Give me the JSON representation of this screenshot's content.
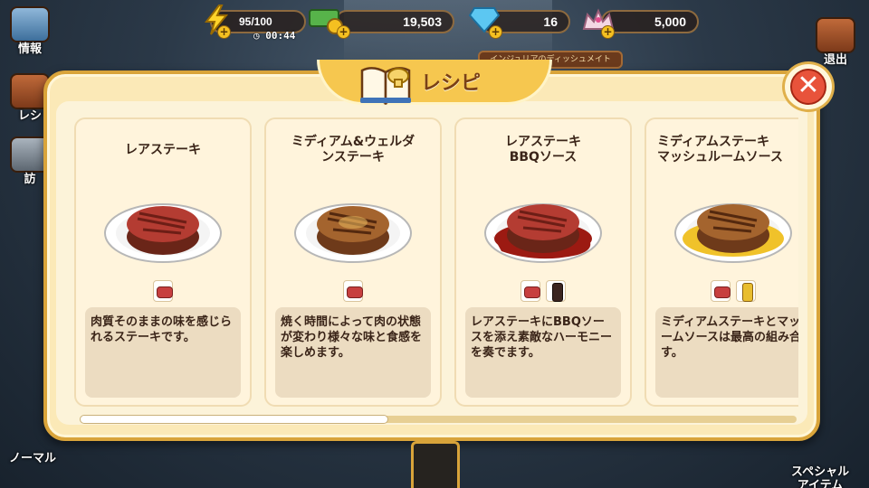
{
  "hud": {
    "energy": "95/100",
    "energy_timer": "00:44",
    "cash": "19,503",
    "gems": "16",
    "tickets": "5,000"
  },
  "background": {
    "sign": "インジュリアのディッシュメイト"
  },
  "side_menu": {
    "info": "情報",
    "recipe": "レシ",
    "visit": "訪",
    "exit": "退出",
    "normal": "ノーマル",
    "special": "スペシャル\nアイテム"
  },
  "modal": {
    "title": "レシピ",
    "close_glyph": "✕"
  },
  "recipes": [
    {
      "title": "レアステーキ",
      "ingredients": [
        "meat"
      ],
      "sauce": "",
      "description": "肉質そのままの味を感じられるステーキです。"
    },
    {
      "title": "ミディアム&ウェルダ\nンステーキ",
      "ingredients": [
        "meat"
      ],
      "sauce": "",
      "description": "焼く時間によって肉の状態が変わり様々な味と食感を楽しめます。"
    },
    {
      "title": "レアステーキ\nBBQソース",
      "ingredients": [
        "meat",
        "bbq-sauce"
      ],
      "sauce": "bbq",
      "description": "レアステーキにBBQソースを添え素敵なハーモニーを奏でます。"
    },
    {
      "title": "ミディアムステーキ\nマッシュルームソース",
      "ingredients": [
        "meat",
        "mushroom-sauce"
      ],
      "sauce": "mushroom",
      "description": "ミディアムステーキとマッシュルームソースは最高の組み合せです。"
    }
  ],
  "scroll": {
    "position_fraction": 0.43
  },
  "colors": {
    "accent_gold": "#d9a43a",
    "title_brown": "#7a4016",
    "close_red": "#e8533b",
    "bbq_sauce": "#9c1a12",
    "mushroom_sauce": "#f0c22a"
  }
}
